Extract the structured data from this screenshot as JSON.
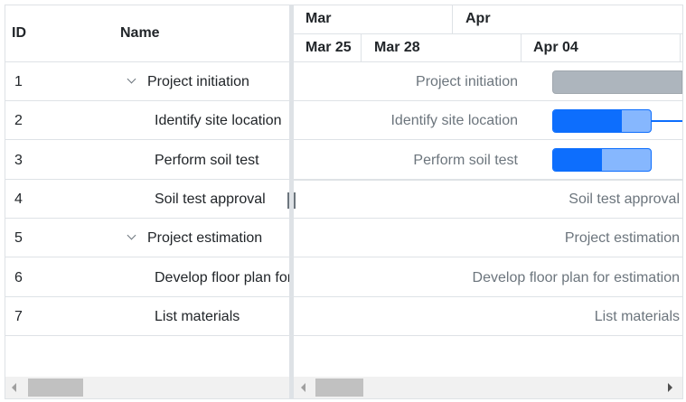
{
  "grid": {
    "columns": {
      "id": "ID",
      "name": "Name"
    },
    "rows": [
      {
        "id": "1",
        "name": "Project initiation",
        "parent": true
      },
      {
        "id": "2",
        "name": "Identify site location",
        "parent": false
      },
      {
        "id": "3",
        "name": "Perform soil test",
        "parent": false
      },
      {
        "id": "4",
        "name": "Soil test approval",
        "parent": false
      },
      {
        "id": "5",
        "name": "Project estimation",
        "parent": true
      },
      {
        "id": "6",
        "name": "Develop floor plan for estimation",
        "parent": false
      },
      {
        "id": "7",
        "name": "List materials",
        "parent": false
      }
    ]
  },
  "timeline": {
    "months": [
      "Mar",
      "Apr"
    ],
    "weeks": [
      "Mar 25",
      "Mar 28",
      "Apr 04"
    ]
  },
  "chart": {
    "labels": [
      "Project initiation",
      "Identify site location",
      "Perform soil test",
      "Soil test approval",
      "Project estimation",
      "Develop floor plan for estimation",
      "List materials"
    ],
    "progress": {
      "identify_site_location": 70,
      "perform_soil_test": 50
    }
  },
  "colors": {
    "bar": "#0d6efd",
    "progress_bg": "#86b7fe",
    "parent_bar": "#adb5bd"
  }
}
